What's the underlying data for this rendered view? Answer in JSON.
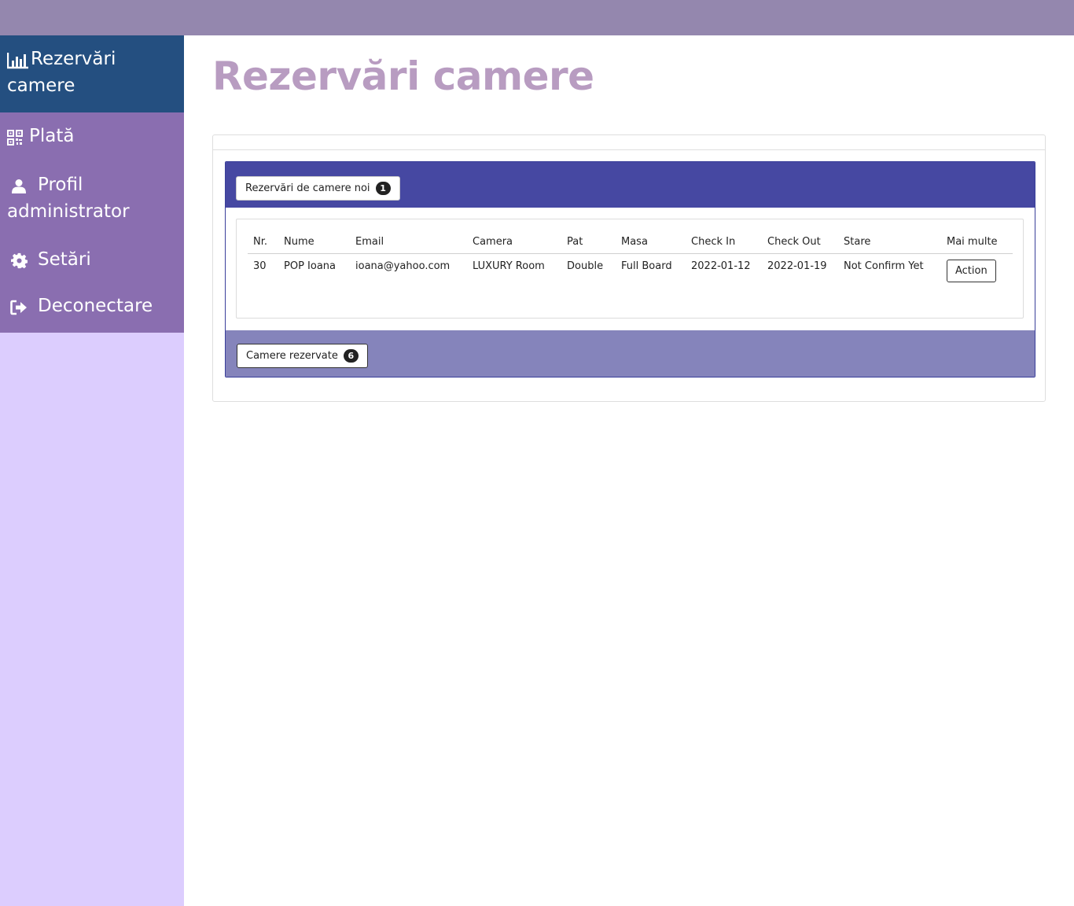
{
  "sidebar": {
    "items": [
      {
        "label": "Rezervări",
        "label2": "camere",
        "icon": "bar-chart-icon",
        "active": true
      },
      {
        "label": "Plată",
        "icon": "qrcode-icon"
      },
      {
        "label": "Profil",
        "label2": "administrator",
        "icon": "user-icon"
      },
      {
        "label": "Setări",
        "icon": "gear-icon"
      },
      {
        "label": "Deconectare",
        "icon": "sign-out-icon"
      }
    ]
  },
  "page": {
    "title": "Rezervări camere"
  },
  "new_bookings": {
    "label": "Rezervări de camere noi",
    "count": "1",
    "table": {
      "headers": [
        "Nr.",
        "Nume",
        "Email",
        "Camera",
        "Pat",
        "Masa",
        "Check In",
        "Check Out",
        "Stare",
        "Mai multe"
      ],
      "rows": [
        {
          "nr": "30",
          "nume": "POP Ioana",
          "email": "ioana@yahoo.com",
          "camera": "LUXURY Room",
          "pat": "Double",
          "masa": "Full Board",
          "check_in": "2022-01-12",
          "check_out": "2022-01-19",
          "stare": "Not Confirm Yet",
          "action": "Action"
        }
      ]
    }
  },
  "booked_rooms": {
    "label": "Camere rezervate",
    "count": "6"
  },
  "colors": {
    "topbar": "#9487ae",
    "sidebar_bg": "#dccdfe",
    "menu_bg": "#8a6eb0",
    "menu_active": "#244f80",
    "title": "#b89cc1",
    "panel_head": "#4648a2",
    "panel_foot": "#8584bb"
  }
}
